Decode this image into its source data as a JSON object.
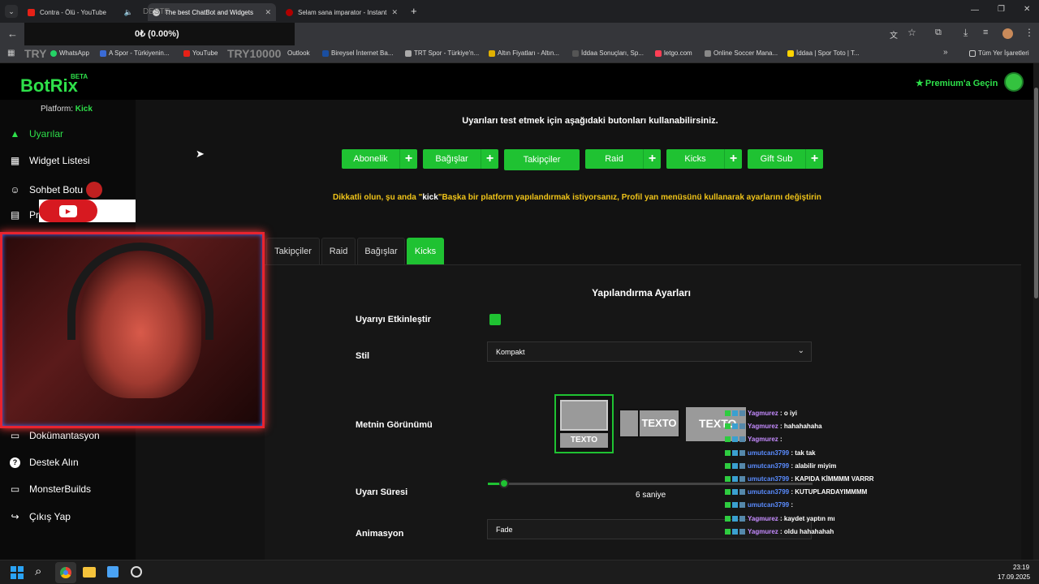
{
  "browser": {
    "tabs": [
      {
        "title": "Contra - Ölü - YouTube",
        "fav": "#e62117",
        "active": false
      },
      {
        "title": "The best ChatBot and Widgets",
        "fav": "#cccccc",
        "active": true
      },
      {
        "title": "Selam sana imparator - Instant",
        "fav": "#b00000",
        "active": false
      }
    ],
    "overlay_price": "0₺ (0.00%)",
    "overlay_ticker": "TRY10000",
    "overlay_ticker_left": "TRY",
    "overlay_top_text": "DESTE",
    "bookmarks": [
      {
        "label": "WhatsApp",
        "color": "#25d366"
      },
      {
        "label": "A Spor - Türkiyenin...",
        "color": "#3a6bd6"
      },
      {
        "label": "YouTube",
        "color": "#e62117"
      },
      {
        "label": "Outlook",
        "color": "#0a64c8"
      },
      {
        "label": "Bireysel İnternet Ba...",
        "color": "#1a4ea0"
      },
      {
        "label": "TRT Spor - Türkiye'n...",
        "color": "#aaaaaa"
      },
      {
        "label": "Altın Fiyatları - Altın...",
        "color": "#e0b000"
      },
      {
        "label": "İddaa Sonuçları, Sp...",
        "color": "#333333"
      },
      {
        "label": "letgo.com",
        "color": "#ff3f55"
      },
      {
        "label": "Online Soccer Mana...",
        "color": "#888888"
      },
      {
        "label": "İddaa | Spor Toto | T...",
        "color": "#ffd400"
      }
    ],
    "all_bookmarks": "Tüm Yer İşaretleri"
  },
  "app": {
    "logo": "BotRix",
    "logo_badge": "BETA",
    "premium": "Premium'a Geçin",
    "platform_label": "Platform:",
    "platform_value": "Kick",
    "sidebar": {
      "items_top": [
        {
          "label": "Uyarılar",
          "icon": "warning-icon"
        },
        {
          "label": "Widget Listesi",
          "icon": "grid-icon"
        },
        {
          "label": "Sohbet Botu",
          "icon": "robot-icon"
        },
        {
          "label": "Pro",
          "icon": "id-card-icon"
        }
      ],
      "items_bottom": [
        {
          "label": "Dokümantasyon",
          "icon": "doc-icon"
        },
        {
          "label": "Destek Alın",
          "icon": "help-icon"
        },
        {
          "label": "MonsterBuilds",
          "icon": "monitor-icon"
        },
        {
          "label": "Çıkış Yap",
          "icon": "logout-icon"
        }
      ]
    },
    "test_instruction": "Uyarıları test etmek için aşağıdaki butonları kullanabilirsiniz.",
    "test_buttons": [
      "Abonelik",
      "Bağışlar",
      "Takipçiler",
      "Raid",
      "Kicks",
      "Gift Sub"
    ],
    "warning_pre": "Dikkatli olun, şu anda \"",
    "warning_platform": "kick",
    "warning_post": "\"Başka bir platform yapılandırmak istiyorsanız, Profil yan menüsünü kullanarak ayarlarını değiştirin",
    "config_tabs": [
      "Takipçiler",
      "Raid",
      "Bağışlar",
      "Kicks"
    ],
    "active_config_tab": "Kicks",
    "config_title": "Yapılandırma Ayarları",
    "fields": {
      "enable_label": "Uyarıyı Etkinleştir",
      "enable_checked": true,
      "style_label": "Stil",
      "style_value": "Kompakt",
      "text_view_label": "Metnin Görünümü",
      "text_sample": "TEXTO",
      "duration_label": "Uyarı Süresi",
      "duration_value": "6 saniye",
      "duration_fraction": 0.05,
      "animation_label": "Animasyon",
      "animation_value": "Fade"
    }
  },
  "chat": [
    {
      "user": "Yagmurez",
      "msg": "o iyi",
      "color": "#c58bff"
    },
    {
      "user": "Yagmurez",
      "msg": "hahahahaha",
      "color": "#c58bff"
    },
    {
      "user": "Yagmurez",
      "msg": "",
      "color": "#c58bff"
    },
    {
      "user": "umutcan3799",
      "msg": "tak tak",
      "color": "#5a8cff"
    },
    {
      "user": "umutcan3799",
      "msg": "alabilir miyim",
      "color": "#5a8cff"
    },
    {
      "user": "umutcan3799",
      "msg": "KAPIDA KİMMMM VARRR",
      "color": "#5a8cff"
    },
    {
      "user": "umutcan3799",
      "msg": "KUTUPLARDAYIMMMM",
      "color": "#5a8cff"
    },
    {
      "user": "umutcan3799",
      "msg": "",
      "color": "#5a8cff"
    },
    {
      "user": "Yagmurez",
      "msg": "kaydet yaptın mı",
      "color": "#c58bff"
    },
    {
      "user": "Yagmurez",
      "msg": "oldu hahahahah",
      "color": "#c58bff"
    }
  ],
  "taskbar": {
    "time": "23:19",
    "date": "17.09.2025"
  }
}
